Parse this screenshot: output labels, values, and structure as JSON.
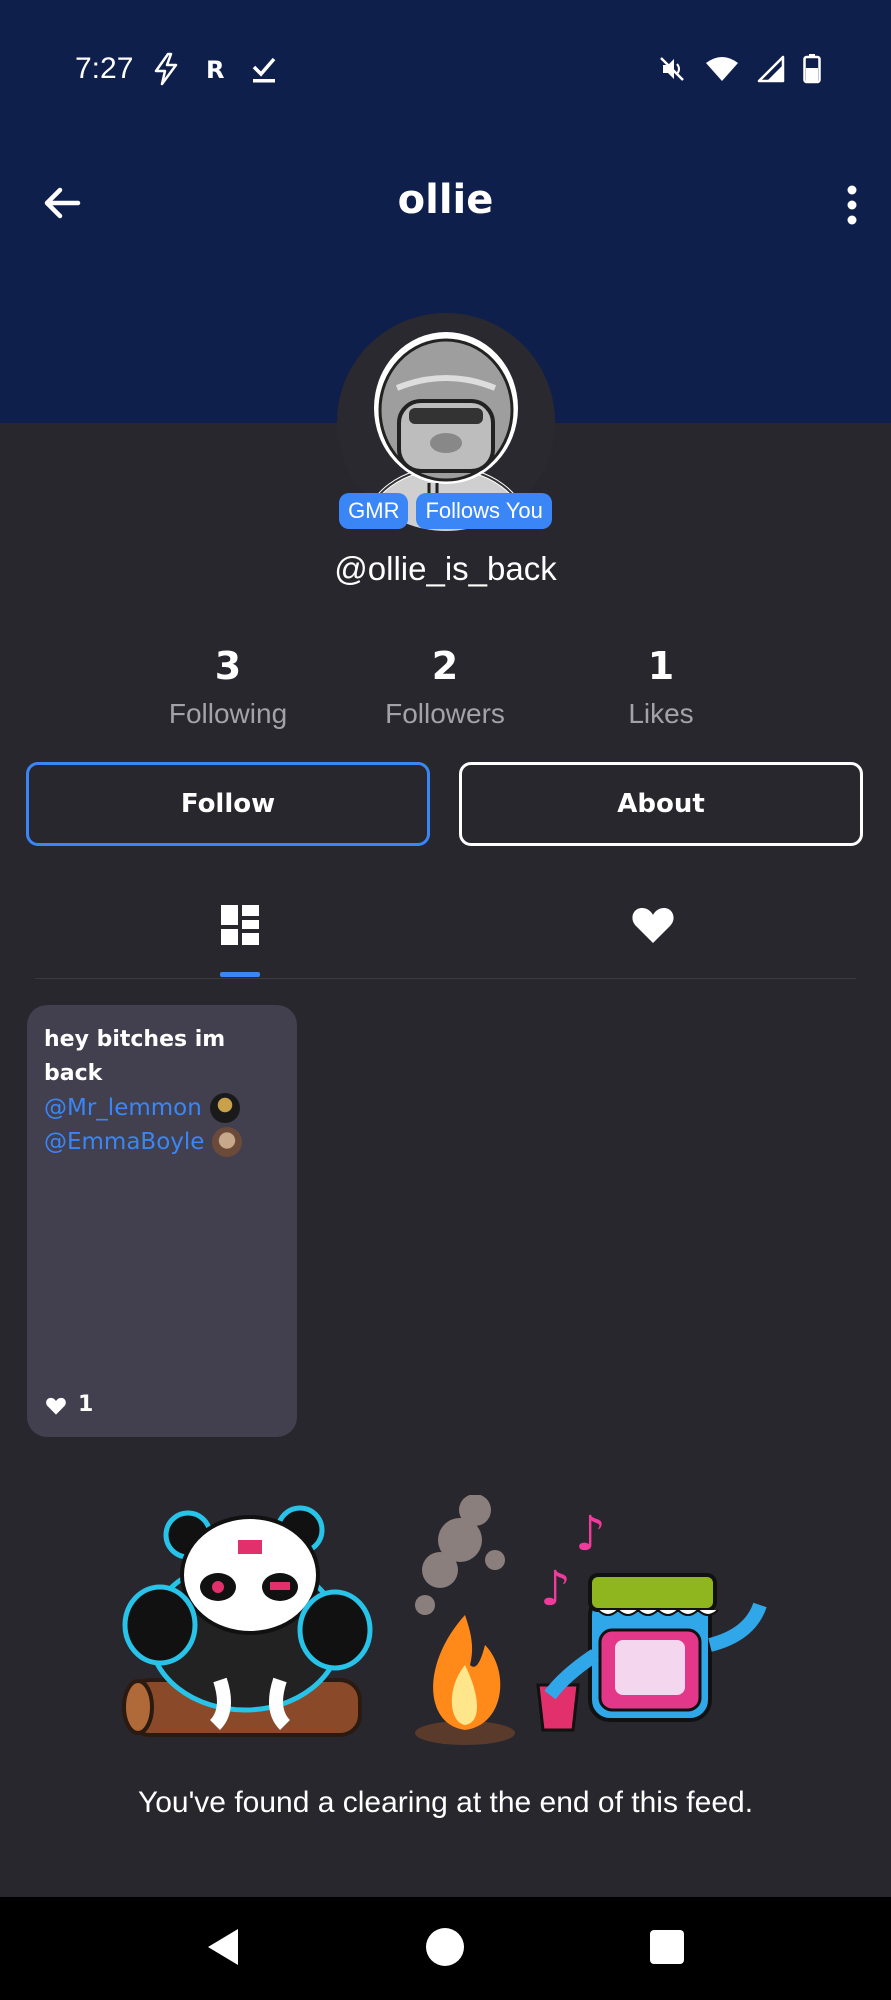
{
  "status_bar": {
    "time": "7:27",
    "left_icons": [
      "flash-icon",
      "r-icon",
      "check-icon"
    ],
    "right_icons": [
      "mute-icon",
      "wifi-icon",
      "signal-icon",
      "battery-icon"
    ]
  },
  "appbar": {
    "title": "ollie",
    "back_icon": "arrow-back-icon",
    "more_icon": "more-vert-icon"
  },
  "profile": {
    "badges": [
      "GMR",
      "Follows You"
    ],
    "handle": "@ollie_is_back",
    "stats": [
      {
        "value": "3",
        "label": "Following"
      },
      {
        "value": "2",
        "label": "Followers"
      },
      {
        "value": "1",
        "label": "Likes"
      }
    ]
  },
  "actions": {
    "follow_label": "Follow",
    "about_label": "About"
  },
  "tabs": [
    {
      "icon": "grid-icon",
      "selected": true
    },
    {
      "icon": "heart-icon",
      "selected": false
    }
  ],
  "posts": [
    {
      "text": "hey bitches im back",
      "mentions": [
        "@Mr_lemmon",
        "@EmmaBoyle"
      ],
      "likes": "1"
    }
  ],
  "feed_end": {
    "message": "You've found a clearing at the end of this feed."
  },
  "colors": {
    "header": "#0f1f4c",
    "background": "#28272d",
    "accent": "#3a86f7",
    "card": "#423f4e"
  }
}
